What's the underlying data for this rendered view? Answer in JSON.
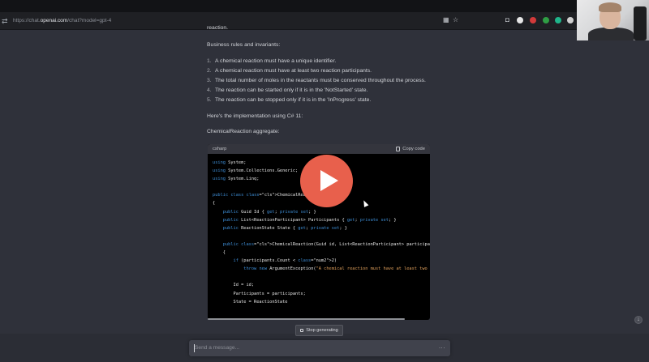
{
  "browser": {
    "url_prefix": "https://chat.",
    "url_domain": "openai.com",
    "url_suffix": "/chat?model=gpt-4"
  },
  "message": {
    "truncated_line": "reaction.",
    "rules_heading": "Business rules and invariants:",
    "rules": [
      {
        "num": "1.",
        "text": "A chemical reaction must have a unique identifier."
      },
      {
        "num": "2.",
        "text": "A chemical reaction must have at least two reaction participants."
      },
      {
        "num": "3.",
        "text": "The total number of moles in the reactants must be conserved throughout the process."
      },
      {
        "num": "4.",
        "text": "The reaction can be started only if it is in the 'NotStarted' state."
      },
      {
        "num": "5.",
        "text": "The reaction can be stopped only if it is in the 'InProgress' state."
      }
    ],
    "impl_line": "Here's the implementation using C# 11:",
    "aggregate_label": "ChemicalReaction aggregate:"
  },
  "code": {
    "language": "csharp",
    "copy_label": "Copy code",
    "lines": [
      "using System;",
      "using System.Collections.Generic;",
      "using System.Linq;",
      "",
      "public class ChemicalReaction",
      "{",
      "    public Guid Id { get; private set; }",
      "    public List<ReactionParticipant> Participants { get; private set; }",
      "    public ReactionState State { get; private set; }",
      "",
      "    public ChemicalReaction(Guid id, List<ReactionParticipant> participants)",
      "    {",
      "        if (participants.Count < 2)",
      "            throw new ArgumentException(\"A chemical reaction must have at least two partici",
      "",
      "        Id = id;",
      "        Participants = participants;",
      "        State = ReactionState"
    ]
  },
  "controls": {
    "stop_label": "Stop generating",
    "composer_placeholder": "Send a message...",
    "composer_more": "..."
  },
  "colors": {
    "background": "#2f313a",
    "play_button": "#e8604c",
    "code_background": "#000000"
  },
  "icons": [
    "site-settings-icon",
    "play-icon",
    "copy-icon",
    "stop-icon",
    "scroll-down-icon"
  ]
}
